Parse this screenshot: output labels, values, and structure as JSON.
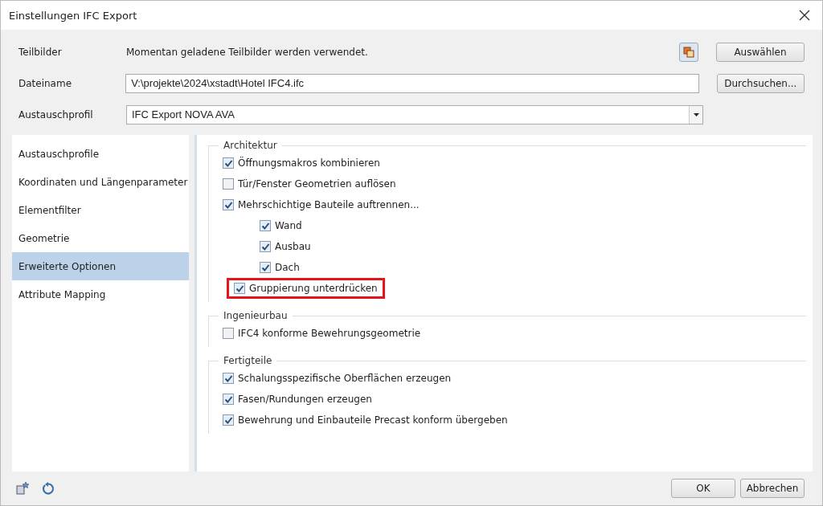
{
  "window": {
    "title": "Einstellungen IFC Export"
  },
  "header_rows": [
    {
      "kind": "text",
      "label": "Teilbilder",
      "value": "Momentan geladene Teilbilder werden verwendet.",
      "icon": true,
      "button": "Auswählen"
    },
    {
      "kind": "input",
      "label": "Dateiname",
      "value": "V:\\projekte\\2024\\xstadt\\Hotel IFC4.ifc",
      "button": "Durchsuchen..."
    },
    {
      "kind": "select",
      "label": "Austauschprofil",
      "value": "IFC Export NOVA AVA"
    }
  ],
  "sidebar": {
    "items": [
      {
        "label": "Austauschprofile",
        "selected": false
      },
      {
        "label": "Koordinaten und Längenparameter",
        "selected": false
      },
      {
        "label": "Elementfilter",
        "selected": false
      },
      {
        "label": "Geometrie",
        "selected": false
      },
      {
        "label": "Erweiterte Optionen",
        "selected": true
      },
      {
        "label": "Attribute Mapping",
        "selected": false
      }
    ]
  },
  "sections": [
    {
      "title": "Architektur",
      "options": [
        {
          "label": "Öffnungsmakros kombinieren",
          "checked": true,
          "highlighted": false
        },
        {
          "label": "Tür/Fenster Geometrien auflösen",
          "checked": false,
          "highlighted": false
        },
        {
          "label": "Mehrschichtige Bauteile auftrennen...",
          "checked": true,
          "highlighted": false,
          "children": [
            {
              "label": "Wand",
              "checked": true,
              "highlighted": false
            },
            {
              "label": "Ausbau",
              "checked": true,
              "highlighted": false
            },
            {
              "label": "Dach",
              "checked": true,
              "highlighted": false
            }
          ]
        },
        {
          "label": "Gruppierung unterdrücken",
          "checked": true,
          "highlighted": true
        }
      ]
    },
    {
      "title": "Ingenieurbau",
      "options": [
        {
          "label": "IFC4 konforme Bewehrungsgeometrie",
          "checked": false,
          "highlighted": false
        }
      ]
    },
    {
      "title": "Fertigteile",
      "options": [
        {
          "label": "Schalungsspezifische Oberflächen erzeugen",
          "checked": true,
          "highlighted": false
        },
        {
          "label": "Fasen/Rundungen erzeugen",
          "checked": true,
          "highlighted": false
        },
        {
          "label": "Bewehrung und Einbauteile Precast konform übergeben",
          "checked": true,
          "highlighted": false
        }
      ]
    }
  ],
  "footer": {
    "buttons": [
      "OK",
      "Abbrechen"
    ]
  }
}
